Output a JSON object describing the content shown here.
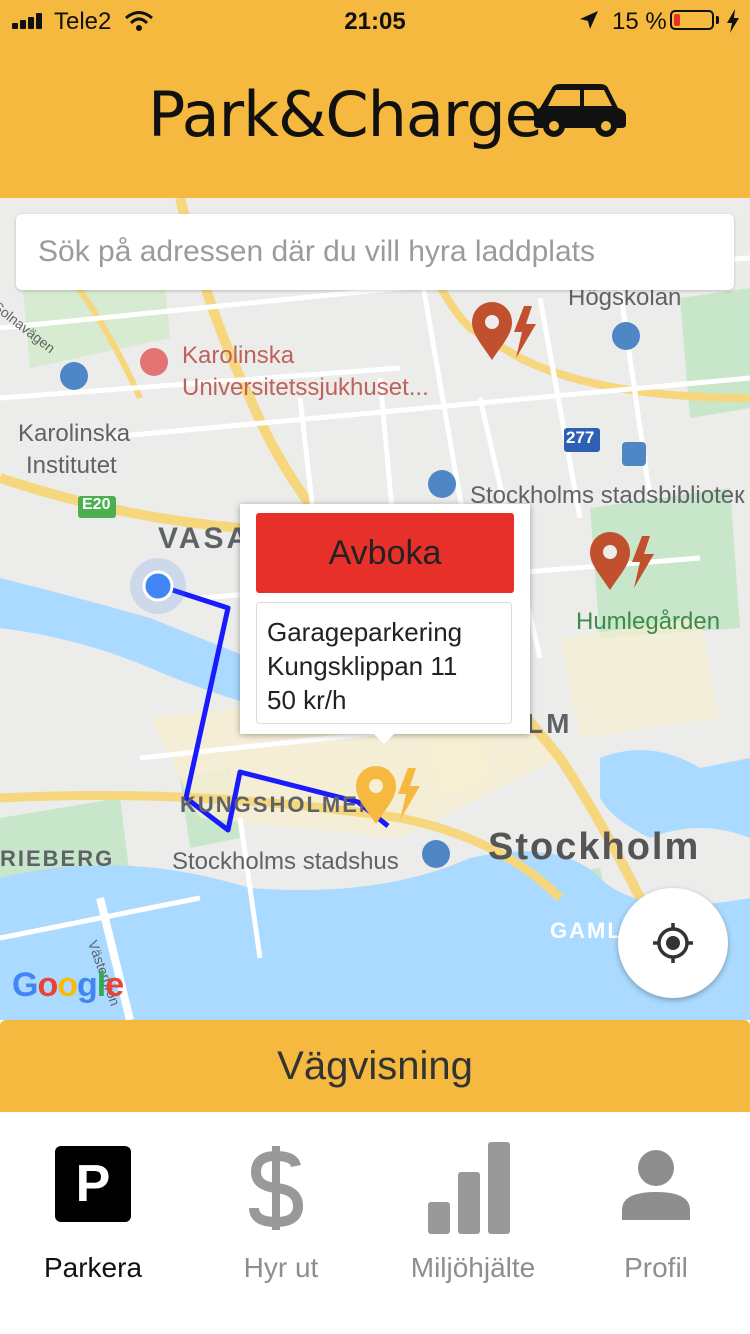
{
  "status_bar": {
    "carrier": "Tele2",
    "time": "21:05",
    "battery_percent": "15 %",
    "battery_level": 0.15,
    "icons": [
      "signal-icon",
      "wifi-icon",
      "location-arrow-icon",
      "battery-icon",
      "charging-bolt-icon"
    ]
  },
  "header": {
    "title": "Park&Charge",
    "icon": "car-icon"
  },
  "search": {
    "placeholder": "Sök på adressen där du vill hyra laddplats",
    "value": ""
  },
  "map": {
    "labels": {
      "karolinska_hospital_1": "Karolinska",
      "karolinska_hospital_2": "Universitetssjukhuset...",
      "karolinska_institute_1": "Karolinska",
      "karolinska_institute_2": "Institutet",
      "hogskolan": "Högskolan",
      "library": "Stockholms stadsbiblioteк",
      "humlegarden": "Humlegården",
      "vasastan": "VASA",
      "norrmalm": "NORRMALM",
      "kungsholmen": "KUNGSHOLMEN",
      "stockholm": "Stockholm",
      "stadshus": "Stockholms stadshus",
      "rieberg": "RIEBERG",
      "gamla": "GAMLA",
      "solnavagen": "Solnavägen",
      "vasterbron": "Västerbron",
      "e20": "E20",
      "route277": "277",
      "google": "Google"
    },
    "colors": {
      "route": "#1a1aff",
      "marker_available": "#c1502e",
      "marker_selected": "#f5b93f",
      "water": "#aadaff",
      "park": "#c8e6c9"
    }
  },
  "popup": {
    "cancel_label": "Avboka",
    "info_line1": "Garageparkering",
    "info_line2": "Kungsklippan 11",
    "info_line3": "50 kr/h"
  },
  "directions_button": "Vägvisning",
  "tabs": [
    {
      "label": "Parkera",
      "icon": "parking-icon",
      "active": true
    },
    {
      "label": "Hyr ut",
      "icon": "dollar-icon",
      "active": false
    },
    {
      "label": "Miljöhjälte",
      "icon": "bar-chart-icon",
      "active": false
    },
    {
      "label": "Profil",
      "icon": "person-icon",
      "active": false
    }
  ]
}
